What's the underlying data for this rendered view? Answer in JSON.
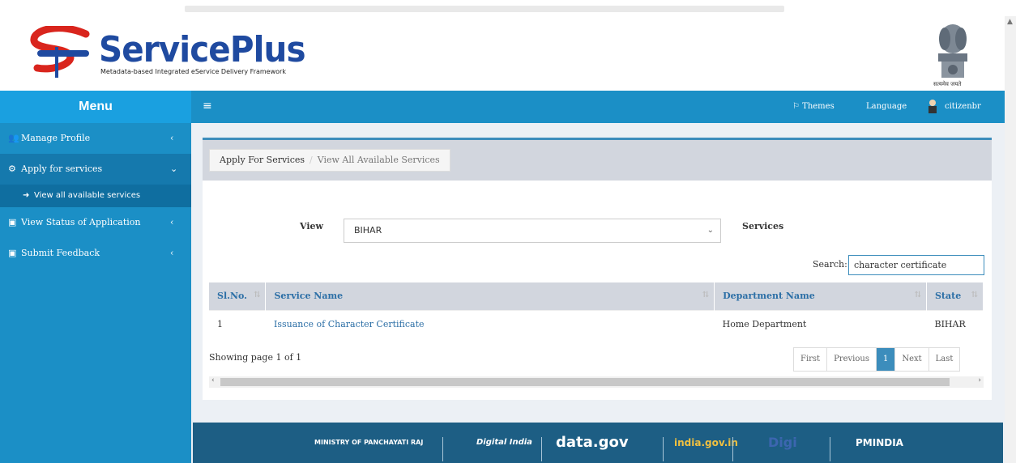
{
  "header": {
    "logo_title": "ServicePlus",
    "logo_subtitle": "Metadata-based Integrated eService Delivery Framework",
    "emblem_text": "सत्यमेव जयते"
  },
  "sidebar": {
    "menu_title": "Menu",
    "items": [
      {
        "label": "Manage Profile",
        "icon": "users-icon"
      },
      {
        "label": "Apply for services",
        "icon": "cogs-icon",
        "sub": "View all available services"
      },
      {
        "label": "View Status of Application",
        "icon": "list-icon"
      },
      {
        "label": "Submit Feedback",
        "icon": "comment-icon"
      }
    ]
  },
  "topbar": {
    "themes": "Themes",
    "language": "Language",
    "user": "citizenbr"
  },
  "breadcrumb": {
    "root": "Apply For Services",
    "current": "View All Available Services"
  },
  "filters": {
    "view_label": "View",
    "view_value": "BIHAR",
    "services_label": "Services",
    "search_label": "Search:",
    "search_value": "character certificate"
  },
  "table": {
    "headers": [
      "Sl.No.",
      "Service Name",
      "Department Name",
      "State"
    ],
    "rows": [
      [
        "1",
        "Issuance of Character Certificate",
        "Home Department",
        "BIHAR"
      ]
    ]
  },
  "pagination": {
    "showing": "Showing page 1 of 1",
    "first": "First",
    "previous": "Previous",
    "page": "1",
    "next": "Next",
    "last": "Last"
  },
  "footer": {
    "items": [
      "MINISTRY OF PANCHAYATI RAJ",
      "Digital India",
      "data.gov",
      "india.gov.in",
      "Digi",
      "PMINDIA"
    ]
  },
  "colors": {
    "sidebar": "#1b8fc6",
    "menu_header": "#1aa0e0",
    "accent": "#3c8dbc",
    "footer": "#1d5e84",
    "logo": "#1f4aa0"
  }
}
